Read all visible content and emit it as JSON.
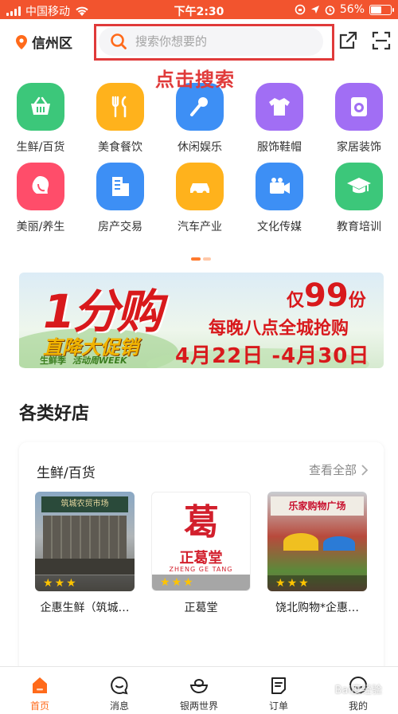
{
  "status_bar": {
    "carrier": "中国移动",
    "time": "下午2:30",
    "battery_pct": "56%",
    "battery_level": 0.56
  },
  "header": {
    "city": "信州区",
    "search_placeholder": "搜索你想要的",
    "annotation": "点击搜索"
  },
  "categories": [
    {
      "label": "生鲜/百货",
      "icon": "basket-icon",
      "color": "#3cc77a"
    },
    {
      "label": "美食餐饮",
      "icon": "fork-knife-icon",
      "color": "#ffb21c"
    },
    {
      "label": "休闲娱乐",
      "icon": "microphone-icon",
      "color": "#3d8ff5"
    },
    {
      "label": "服饰鞋帽",
      "icon": "tshirt-icon",
      "color": "#a16ef4"
    },
    {
      "label": "家居装饰",
      "icon": "washer-icon",
      "color": "#a16ef4"
    },
    {
      "label": "美丽/养生",
      "icon": "woman-face-icon",
      "color": "#ff4d6a"
    },
    {
      "label": "房产交易",
      "icon": "building-icon",
      "color": "#3d8ff5"
    },
    {
      "label": "汽车产业",
      "icon": "car-icon",
      "color": "#ffb21c"
    },
    {
      "label": "文化传媒",
      "icon": "camera-icon",
      "color": "#3d8ff5"
    },
    {
      "label": "教育培训",
      "icon": "graduation-cap-icon",
      "color": "#3cc77a"
    }
  ],
  "banner": {
    "headline": "1分购",
    "subheadline": "直降大促销",
    "tag": "生鲜季",
    "tag2": "活动周WEEK",
    "offer_prefix": "仅",
    "offer_num": "99",
    "offer_suffix": "份",
    "offer_line": "每晚八点全城抢购",
    "date_range": "4月22日 -4月30日"
  },
  "section": {
    "title": "各类好店"
  },
  "shop_card": {
    "title": "生鲜/百货",
    "more": "查看全部",
    "shops": [
      {
        "name": "企惠生鲜（筑城…",
        "rating": 3,
        "thumb_sign": "筑城农贸市场"
      },
      {
        "name": "正葛堂",
        "rating": 3,
        "thumb_sign": "正葛堂",
        "thumb_sub": "ZHENG GE TANG"
      },
      {
        "name": "饶北购物*企惠…",
        "rating": 3,
        "thumb_sign": "乐家购物广场"
      }
    ]
  },
  "tabbar": {
    "tabs": [
      {
        "label": "首页",
        "active": true
      },
      {
        "label": "消息",
        "active": false
      },
      {
        "label": "银两世界",
        "active": false
      },
      {
        "label": "订单",
        "active": false
      },
      {
        "label": "我的",
        "active": false
      }
    ],
    "watermark": "Bai度经验"
  },
  "colors": {
    "accent": "#ff6a1a",
    "status_bar": "#f2542e",
    "annotation": "#e03a3a"
  }
}
